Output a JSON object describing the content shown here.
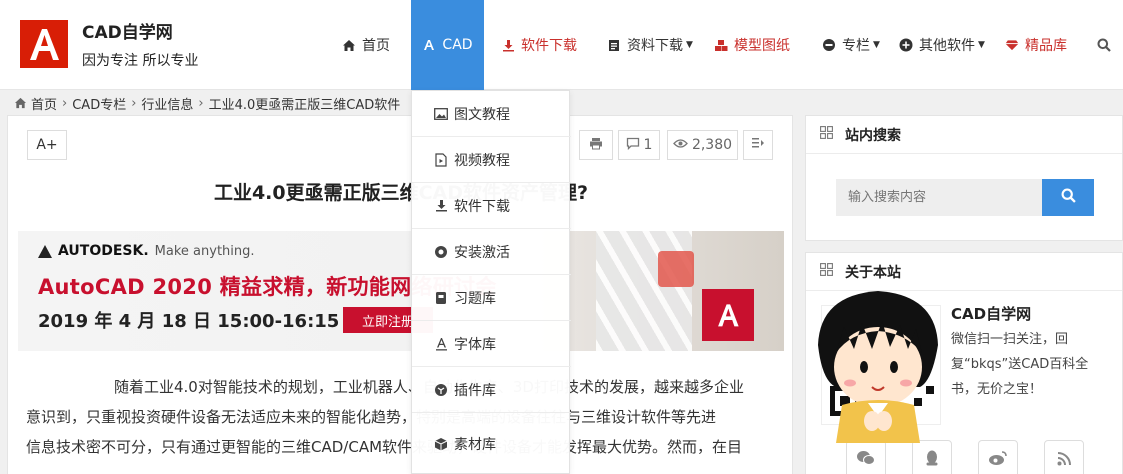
{
  "header": {
    "site_name": "CAD自学网",
    "slogan": "因为专注 所以专业",
    "logo_letter": "A",
    "brand_color": "#d81e06"
  },
  "nav": {
    "home": "首页",
    "cad": "CAD",
    "software": "软件下载",
    "materials": "资料下载",
    "models": "模型图纸",
    "column": "专栏",
    "other": "其他软件",
    "premium": "精品库",
    "active_color": "#3a8dde",
    "accent_color": "#c9302c"
  },
  "breadcrumb": {
    "home": "首页",
    "column": "CAD专栏",
    "category": "行业信息",
    "current": "工业4.0更亟需正版三维CAD软件"
  },
  "article": {
    "font_button": "A+",
    "comment_count": "1",
    "view_count": "2,380",
    "title": "工业4.0更亟需正版三维CAD软件资产管理?",
    "banner": {
      "brand": "AUTODESK.",
      "tagline": "Make anything.",
      "headline": "AutoCAD 2020 精益求精，新功能网络研讨会",
      "date": "2019 年 4 月 18 日 15:00-16:15",
      "register": "立即注册"
    },
    "para1_line1": "随着工业4.0对智能技术的规划，工业机器人、自动化生产、3D打印技术的发展，越来越多企业",
    "para1_line2": "意识到，只重视投资硬件设备无法适应未来的智能化趋势，特别是高端的设备往往与三维设计软件等先进",
    "para1_line3": "信息技术密不可分，只有通过更智能的三维CAD/CAM软件来驱动，硬件设备才能发挥最大优势。然而，在目"
  },
  "dropdown": {
    "items": [
      "图文教程",
      "视频教程",
      "软件下载",
      "安装激活",
      "习题库",
      "字体库",
      "插件库",
      "素材库"
    ]
  },
  "sidebar": {
    "search_title": "站内搜索",
    "search_placeholder": "输入搜索内容",
    "about_title": "关于本站",
    "about_name": "CAD自学网",
    "about_desc": "微信扫一扫关注，回复“bkqs”送CAD百科全书，无价之宝！"
  }
}
